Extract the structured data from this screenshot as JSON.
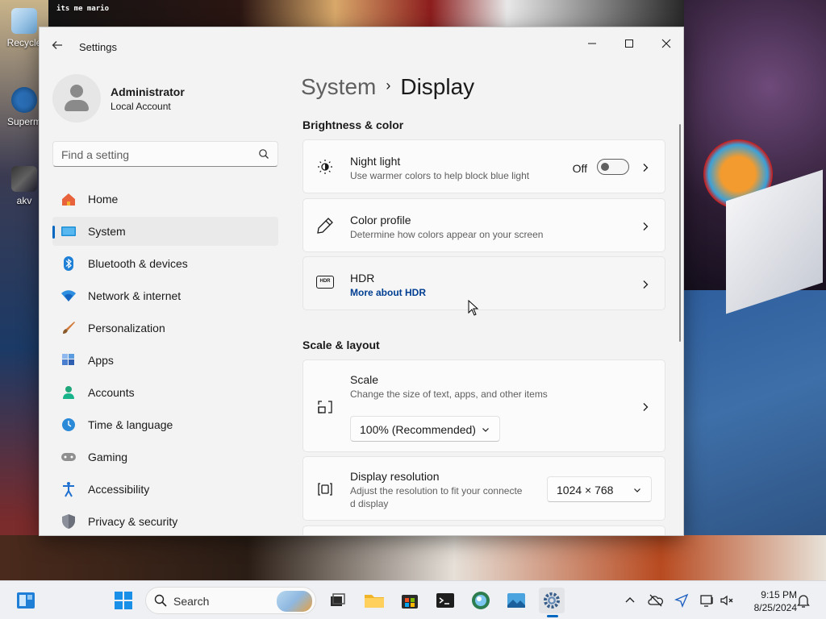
{
  "desktop": {
    "icons": [
      {
        "label": "Recycle"
      },
      {
        "label": "Superm"
      },
      {
        "label": "akv"
      }
    ],
    "wallpaper_text": "its me mario"
  },
  "window": {
    "app_title": "Settings",
    "minimize_glyph": "—",
    "maximize_glyph": "☐",
    "close_glyph": "✕"
  },
  "profile": {
    "name": "Administrator",
    "account_type": "Local Account"
  },
  "search": {
    "placeholder": "Find a setting"
  },
  "sidebar": {
    "items": [
      {
        "label": "Home",
        "icon": "home-icon",
        "selected": false
      },
      {
        "label": "System",
        "icon": "system-icon",
        "selected": true
      },
      {
        "label": "Bluetooth & devices",
        "icon": "bluetooth-icon",
        "selected": false
      },
      {
        "label": "Network & internet",
        "icon": "wifi-icon",
        "selected": false
      },
      {
        "label": "Personalization",
        "icon": "brush-icon",
        "selected": false
      },
      {
        "label": "Apps",
        "icon": "apps-icon",
        "selected": false
      },
      {
        "label": "Accounts",
        "icon": "person-icon",
        "selected": false
      },
      {
        "label": "Time & language",
        "icon": "globe-clock-icon",
        "selected": false
      },
      {
        "label": "Gaming",
        "icon": "gamepad-icon",
        "selected": false
      },
      {
        "label": "Accessibility",
        "icon": "accessibility-icon",
        "selected": false
      },
      {
        "label": "Privacy & security",
        "icon": "shield-icon",
        "selected": false
      }
    ]
  },
  "main": {
    "breadcrumb": {
      "parent": "System",
      "separator": "›",
      "current": "Display"
    },
    "sections": {
      "brightness": "Brightness & color",
      "scale_layout": "Scale & layout"
    },
    "night_light": {
      "title": "Night light",
      "subtitle": "Use warmer colors to help block blue light",
      "state_label": "Off"
    },
    "color_profile": {
      "title": "Color profile",
      "subtitle": "Determine how colors appear on your screen"
    },
    "hdr": {
      "title": "HDR",
      "link": "More about HDR",
      "icon_text": "HDR"
    },
    "scale": {
      "title": "Scale",
      "subtitle": "Change the size of text, apps, and other items",
      "value": "100% (Recommended)"
    },
    "resolution": {
      "title": "Display resolution",
      "subtitle_line1": "Adjust the resolution to fit your connecte",
      "subtitle_line2": "d display",
      "value": "1024 × 768"
    }
  },
  "taskbar": {
    "search_label": "Search",
    "time": "9:15 PM",
    "date": "8/25/2024"
  },
  "colors": {
    "accent": "#0067c0",
    "link": "#003e92",
    "window_bg": "#f3f3f3",
    "card_bg": "#fbfbfb"
  }
}
